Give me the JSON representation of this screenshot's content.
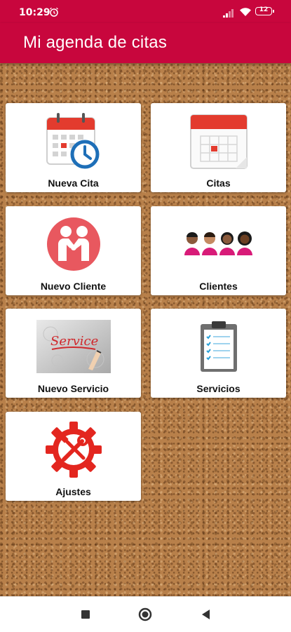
{
  "status_bar": {
    "time": "10:29",
    "battery": "12"
  },
  "app_bar": {
    "title": "Mi agenda de citas"
  },
  "tiles": [
    {
      "label": "Nueva Cita",
      "icon": "calendar-clock-icon"
    },
    {
      "label": "Citas",
      "icon": "calendar-icon"
    },
    {
      "label": "Nuevo Cliente",
      "icon": "handshake-icon"
    },
    {
      "label": "Clientes",
      "icon": "people-group-icon"
    },
    {
      "label": "Nuevo Servicio",
      "icon": "service-image-icon",
      "image_text": "Service"
    },
    {
      "label": "Servicios",
      "icon": "clipboard-checklist-icon"
    },
    {
      "label": "Ajustes",
      "icon": "settings-tools-icon"
    }
  ],
  "colors": {
    "primary": "#c8063d",
    "icon_red": "#e33b2e",
    "cork": "#b8804a"
  }
}
